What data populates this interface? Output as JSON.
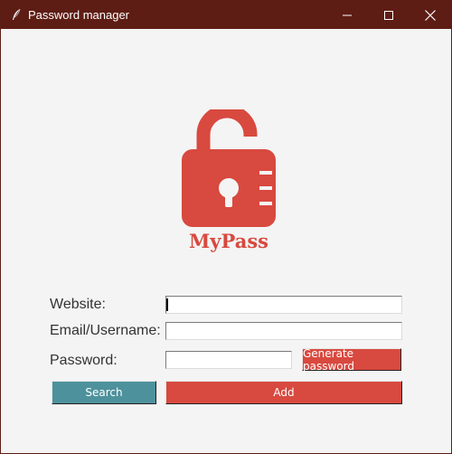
{
  "window": {
    "title": "Password manager",
    "controls": {
      "minimize": "minimize-icon",
      "maximize": "maximize-icon",
      "close": "close-icon"
    }
  },
  "logo": {
    "text": "MyPass",
    "color": "#d8493f"
  },
  "form": {
    "website_label": "Website:",
    "website_value": "",
    "email_label": "Email/Username:",
    "email_value": "",
    "password_label": "Password:",
    "password_value": ""
  },
  "buttons": {
    "generate_label": "Generate password",
    "search_label": "Search",
    "add_label": "Add"
  },
  "colors": {
    "accent_red": "#d8493f",
    "accent_teal": "#4d919c",
    "titlebar": "#5e1d14",
    "background": "#f4f4f4"
  }
}
